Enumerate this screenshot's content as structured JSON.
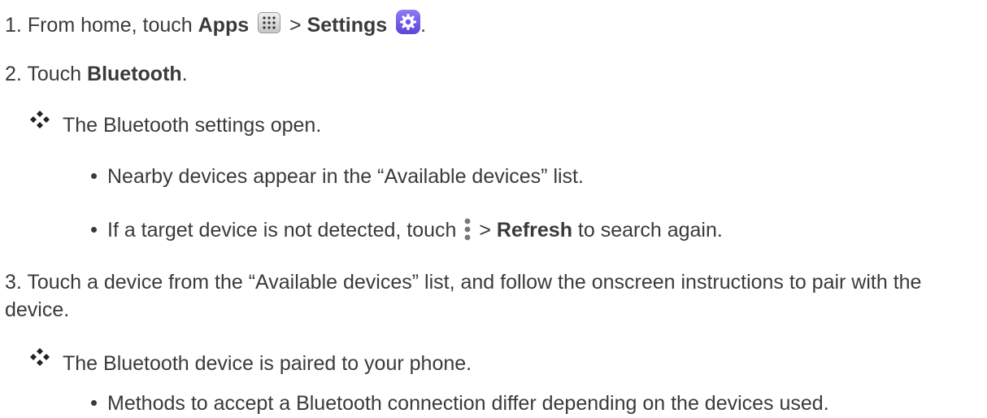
{
  "steps": {
    "step1": {
      "number": "1.",
      "text_a": "From home, touch ",
      "bold_a": "Apps",
      "sep": " > ",
      "bold_b": "Settings",
      "end": "."
    },
    "step2": {
      "number": "2.",
      "text_a": "Touch ",
      "bold_a": "Bluetooth",
      "end": "."
    },
    "step3": {
      "number": "3.",
      "text": "Touch a device from the “Available devices” list, and follow the onscreen instructions to pair with the device."
    }
  },
  "results": {
    "r1": "The Bluetooth settings open.",
    "r2": "The Bluetooth device is paired to your phone."
  },
  "bullets": {
    "b1": "Nearby devices appear in the “Available devices” list.",
    "b2_a": "If a target device is not detected, touch ",
    "b2_sep": " > ",
    "b2_bold": "Refresh",
    "b2_end": " to search again.",
    "b3": "Methods to accept a Bluetooth connection differ depending on the devices used."
  },
  "icons": {
    "apps": "apps-grid-icon",
    "settings": "settings-gear-icon",
    "overflow": "overflow-menu-icon",
    "result": "diamond-bullet-icon"
  },
  "colors": {
    "text": "#3a3a3a",
    "settings_icon": "#6a55e3"
  }
}
